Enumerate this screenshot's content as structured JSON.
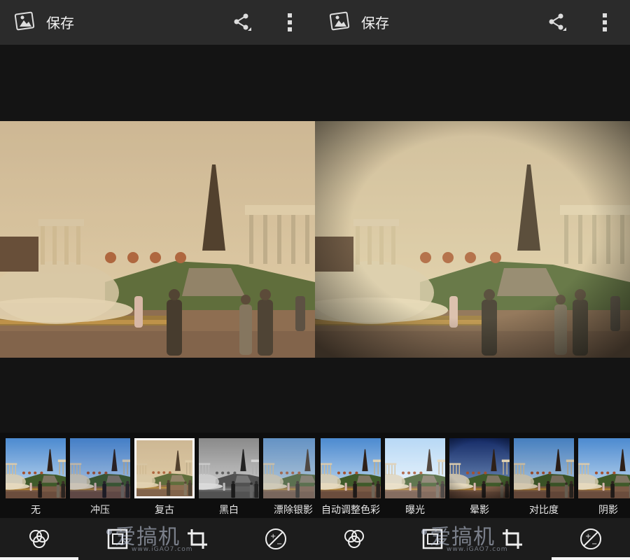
{
  "colors": {
    "action_bar": "#2b2b2b",
    "background": "#141414",
    "strip_background": "#0e0e0e",
    "selected_border": "#ffffff",
    "bottom_bar": "#1c1c1c"
  },
  "panes": [
    {
      "action_bar": {
        "save_label": "保存",
        "app_icon": "photo-editor-icon",
        "share_icon": "share-icon",
        "more_icon": "more-vertical-icon"
      },
      "photo": {
        "style": "retro-vintage",
        "description_icon": "landmark-photo"
      },
      "filters": [
        {
          "label": "无",
          "style": "none",
          "selected": false
        },
        {
          "label": "冲压",
          "style": "punch",
          "selected": false
        },
        {
          "label": "复古",
          "style": "vintage",
          "selected": true
        },
        {
          "label": "黑白",
          "style": "bw",
          "selected": false
        },
        {
          "label": "漂除银影",
          "style": "bleach",
          "selected": false
        }
      ],
      "tools": [
        "filters-icon",
        "frame-icon",
        "crop-icon",
        "exposure-icon"
      ]
    },
    {
      "action_bar": {
        "save_label": "保存",
        "app_icon": "photo-editor-icon",
        "share_icon": "share-icon",
        "more_icon": "more-vertical-icon"
      },
      "photo": {
        "style": "vignette-retro",
        "description_icon": "landmark-photo"
      },
      "filters": [
        {
          "label": "自动调整色彩",
          "style": "auto",
          "selected": false
        },
        {
          "label": "曝光",
          "style": "exposure",
          "selected": false
        },
        {
          "label": "晕影",
          "style": "vignette",
          "selected": false
        },
        {
          "label": "对比度",
          "style": "contrast",
          "selected": false
        },
        {
          "label": "阴影",
          "style": "shadow",
          "selected": false
        }
      ],
      "tools": [
        "filters-icon",
        "frame-icon",
        "crop-icon",
        "exposure-icon"
      ]
    }
  ],
  "watermark": {
    "main": "爱搞机",
    "sub": "www.iGAO7.com"
  }
}
